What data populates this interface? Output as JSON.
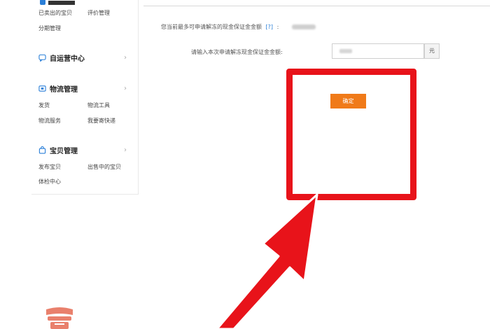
{
  "sidebar": {
    "top_items": [
      "已卖出的宝贝",
      "评价管理",
      "分期管理"
    ],
    "sections": [
      {
        "title": "自运营中心",
        "icon": "chat-bubble-icon",
        "items": []
      },
      {
        "title": "物流管理",
        "icon": "delivery-icon",
        "items": [
          "发货",
          "物流工具",
          "物流服务",
          "我要寄快递"
        ]
      },
      {
        "title": "宝贝管理",
        "icon": "bag-icon",
        "items": [
          "发布宝贝",
          "出售中的宝贝",
          "体检中心"
        ]
      }
    ]
  },
  "main": {
    "available_text": "您当前最多可申请解冻的现金保证金金额",
    "help_link": "[?]",
    "input_label": "请输入本次申请解冻现金保证金金额:",
    "unit": "元",
    "confirm_label": "确定"
  },
  "colors": {
    "accent_orange": "#f07a19",
    "highlight_red": "#e8131a",
    "link_blue": "#2a7fd8"
  }
}
